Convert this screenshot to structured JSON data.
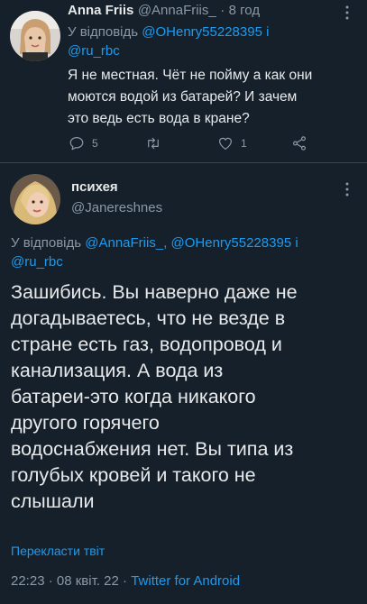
{
  "tweet1": {
    "display_name": "Anna Friis",
    "handle": "@AnnaFriis_",
    "separator": "·",
    "time": "8 год",
    "reply_prefix": "У відповідь",
    "reply_mentions_line1": "@OHenry55228395 і",
    "reply_mentions_line2": "@ru_rbc",
    "text_line1": "Я не местная. Чёт не пойму а как они",
    "text_line2": "моются водой из батарей? И зачем",
    "text_line3": "это ведь есть вода в кране?",
    "replies_count": "5",
    "likes_count": "1"
  },
  "tweet2": {
    "display_name": "психея",
    "handle": "@Janereshnes",
    "reply_prefix": "У відповідь",
    "reply_mentions_line1": "@AnnaFriis_, @OHenry55228395 і",
    "reply_mentions_line2": "@ru_rbc",
    "text_lines": [
      "Зашибись. Вы наверно даже не",
      "догадываетесь, что не везде в",
      "стране есть газ, водопровод и",
      "канализация. А вода из",
      "батареи-это когда никакого",
      "другого горячего",
      "водоснабжения нет. Вы типа из",
      "голубых кровей и такого не",
      "слышали"
    ],
    "translate_label": "Перекласти твіт",
    "meta_time": "22:23",
    "meta_sep": "·",
    "meta_date": "08 квіт. 22",
    "meta_sep2": "·",
    "meta_source": "Twitter for Android"
  },
  "colors": {
    "background": "#15202b",
    "accent": "#1d9bf0",
    "muted": "#8b98a5",
    "text": "#e7e9ea",
    "divider": "#38444d"
  }
}
